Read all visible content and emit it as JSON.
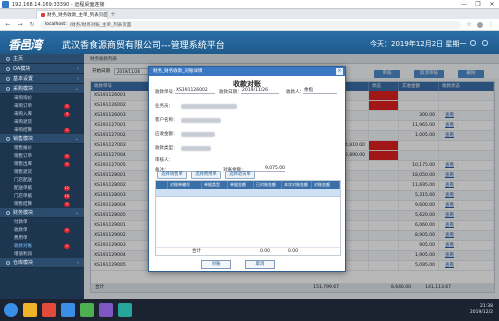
{
  "remote": {
    "title": "192.168.14.169:33390 - 远程桌面连接",
    "controls": [
      "—",
      "❐",
      "✕"
    ]
  },
  "browser": {
    "tab_title": "财务_财务收款_主单_列表页面",
    "url_host": "localhost:",
    "url_path": "/财务/财务对账_主单_列表页面"
  },
  "app": {
    "logo": "香邑湾",
    "system_title": "武汉香食源商贸有限公司---管理系统平台",
    "date": "今天：2019年12月2日 星期一"
  },
  "sidebar": {
    "sections": [
      {
        "label": "主页",
        "items": []
      },
      {
        "label": "OA模块",
        "items": []
      },
      {
        "label": "基本设置",
        "items": []
      },
      {
        "label": "采购模块",
        "items": [
          {
            "label": "采购询价",
            "badge": ""
          },
          {
            "label": "采购订单",
            "badge": "1"
          },
          {
            "label": "采购入库",
            "badge": "3"
          },
          {
            "label": "采购退货",
            "badge": ""
          },
          {
            "label": "采购结算",
            "badge": "1"
          }
        ]
      },
      {
        "label": "销售模块",
        "items": [
          {
            "label": "销售报价",
            "badge": ""
          },
          {
            "label": "销售订单",
            "badge": "1"
          },
          {
            "label": "销售出库",
            "badge": "1"
          },
          {
            "label": "销售退货",
            "badge": ""
          },
          {
            "label": "门店配送",
            "badge": ""
          },
          {
            "label": "配送单据",
            "badge": "12"
          },
          {
            "label": "门店单据",
            "badge": "10"
          },
          {
            "label": "销售结算",
            "badge": "1"
          }
        ]
      },
      {
        "label": "财务模块",
        "items": [
          {
            "label": "付款单",
            "badge": ""
          },
          {
            "label": "收款单",
            "badge": "1"
          },
          {
            "label": "费用单",
            "badge": ""
          },
          {
            "label": "收款对账",
            "badge": "1"
          },
          {
            "label": "增值利润",
            "badge": ""
          }
        ]
      },
      {
        "label": "仓库模块",
        "items": []
      }
    ]
  },
  "main": {
    "breadcrumb": "财务收款列表",
    "filter_date_label": "开始日期",
    "filter_date": "2019/11/26",
    "toolbar": [
      "审核",
      "取消审核",
      "删除"
    ],
    "columns": [
      "收款单号",
      "客户名称",
      "应收金额",
      "状态",
      "实收金额",
      "收款状态"
    ],
    "rows": [
      {
        "id": "XS191126001",
        "amt": "",
        "status": "",
        "recv": "",
        "flag": "red"
      },
      {
        "id": "XS191126002",
        "amt": "",
        "status": "",
        "recv": "",
        "flag": "red"
      },
      {
        "id": "XS191126003",
        "amt": "",
        "status": "",
        "recv": "300.00",
        "flag": ""
      },
      {
        "id": "XS191127001",
        "amt": "",
        "status": "",
        "recv": "11,965.00",
        "flag": ""
      },
      {
        "id": "XS191127002",
        "amt": "",
        "status": "",
        "recv": "1,005.00",
        "flag": ""
      },
      {
        "id": "XS191127003",
        "amt": "4,810.00",
        "status": "",
        "recv": "",
        "flag": "red"
      },
      {
        "id": "XS191127004",
        "amt": "2,890.00",
        "status": "",
        "recv": "",
        "flag": "red"
      },
      {
        "id": "XS191127005",
        "amt": "",
        "status": "",
        "recv": "10,175.00",
        "flag": ""
      },
      {
        "id": "XS191128001",
        "amt": "",
        "status": "",
        "recv": "18,050.00",
        "flag": ""
      },
      {
        "id": "XS191128002",
        "amt": "",
        "status": "",
        "recv": "11,695.00",
        "flag": ""
      },
      {
        "id": "XS191128003",
        "amt": "",
        "status": "",
        "recv": "5,315.00",
        "flag": ""
      },
      {
        "id": "XS191128004",
        "amt": "",
        "status": "",
        "recv": "9,600.00",
        "flag": ""
      },
      {
        "id": "XS191128005",
        "amt": "",
        "status": "",
        "recv": "5,620.00",
        "flag": ""
      },
      {
        "id": "XS191129001",
        "amt": "",
        "status": "",
        "recv": "6,060.00",
        "flag": ""
      },
      {
        "id": "XS191129002",
        "amt": "",
        "status": "",
        "recv": "8,905.00",
        "flag": ""
      },
      {
        "id": "XS191129003",
        "amt": "",
        "status": "",
        "recv": "905.00",
        "flag": ""
      },
      {
        "id": "XS191129004",
        "amt": "",
        "status": "",
        "recv": "1,905.00",
        "flag": ""
      },
      {
        "id": "XS191129005",
        "amt": "",
        "status": "",
        "recv": "5,095.00",
        "flag": ""
      }
    ],
    "row_action": "查看",
    "footer_label": "合计",
    "footer_total1": "151,799.67",
    "footer_total2": "8,646.00",
    "footer_total3": "141,113.67"
  },
  "dialog": {
    "title": "财务_财务收款_对账详情",
    "heading": "收款对账",
    "order_no_label": "收款单号：",
    "order_no": "XS191126002",
    "order_date_label": "收款日期：",
    "order_date": "2019/11/26",
    "receiver_label": "收款人：",
    "receiver": "余指",
    "company_label": "业务员：",
    "customer_label": "客户名称：",
    "amount_label": "应收金额：",
    "type_label": "收款类型：",
    "auditor_label": "审核人：",
    "remark_label": "备注：",
    "check_amount_label": "对账金额：",
    "check_amount": "9,075.00",
    "buttons": [
      "选择销售单",
      "选择费用单",
      "选择退货单"
    ],
    "inner_columns": [
      "对账单编号",
      "单据类型",
      "单据金额",
      "已对账金额",
      "本次对账金额",
      "对账金额"
    ],
    "inner_total_label": "合计",
    "inner_total_a": "0.00",
    "inner_total_b": "0.00",
    "confirm": "对账",
    "cancel": "取消"
  },
  "taskbar": {
    "time": "21:38",
    "date": "2019/12/2"
  }
}
